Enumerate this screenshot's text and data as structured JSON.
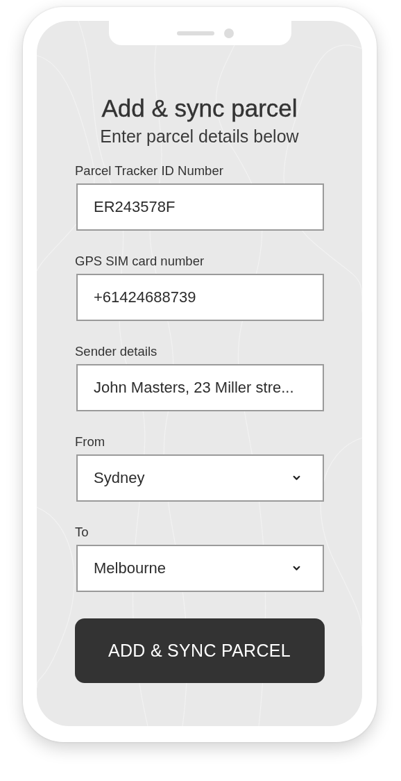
{
  "screen": {
    "title": "Add & sync parcel",
    "subtitle": "Enter parcel details below"
  },
  "fields": [
    {
      "label": "Parcel Tracker ID Number",
      "kind": "text",
      "value": "ER243578F"
    },
    {
      "label": "GPS SIM card number",
      "kind": "text",
      "value": "+61424688739"
    },
    {
      "label": "Sender details",
      "kind": "text",
      "value": "John Masters, 23 Miller stre..."
    },
    {
      "label": "From",
      "kind": "select",
      "value": "Sydney"
    },
    {
      "label": "To",
      "kind": "select",
      "value": "Melbourne"
    }
  ],
  "button": {
    "label": "ADD & SYNC PARCEL"
  }
}
